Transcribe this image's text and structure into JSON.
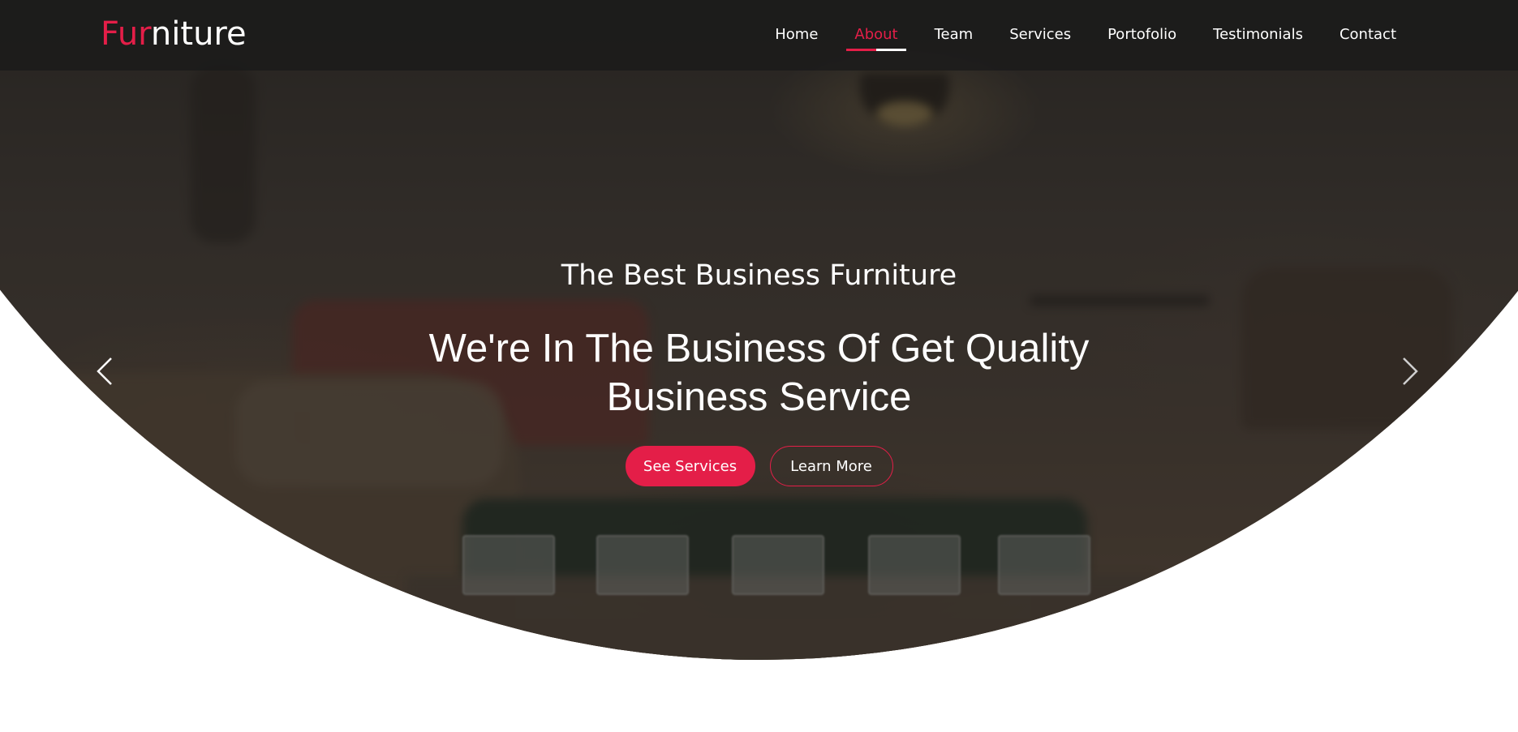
{
  "brand": {
    "logo_accent": "Fur",
    "logo_rest": "niture",
    "accent_color": "#e41e48"
  },
  "nav": {
    "items": [
      {
        "label": "Home"
      },
      {
        "label": "About"
      },
      {
        "label": "Team"
      },
      {
        "label": "Services"
      },
      {
        "label": "Portofolio"
      },
      {
        "label": "Testimonials"
      },
      {
        "label": "Contact"
      }
    ],
    "active": "About"
  },
  "hero": {
    "subtitle": "The Best Business Furniture",
    "title": "We're In The Business Of Get Quality Business Service",
    "primary_button": "See Services",
    "secondary_button": "Learn More",
    "prev_icon": "chevron-left-icon",
    "next_icon": "chevron-right-icon"
  }
}
